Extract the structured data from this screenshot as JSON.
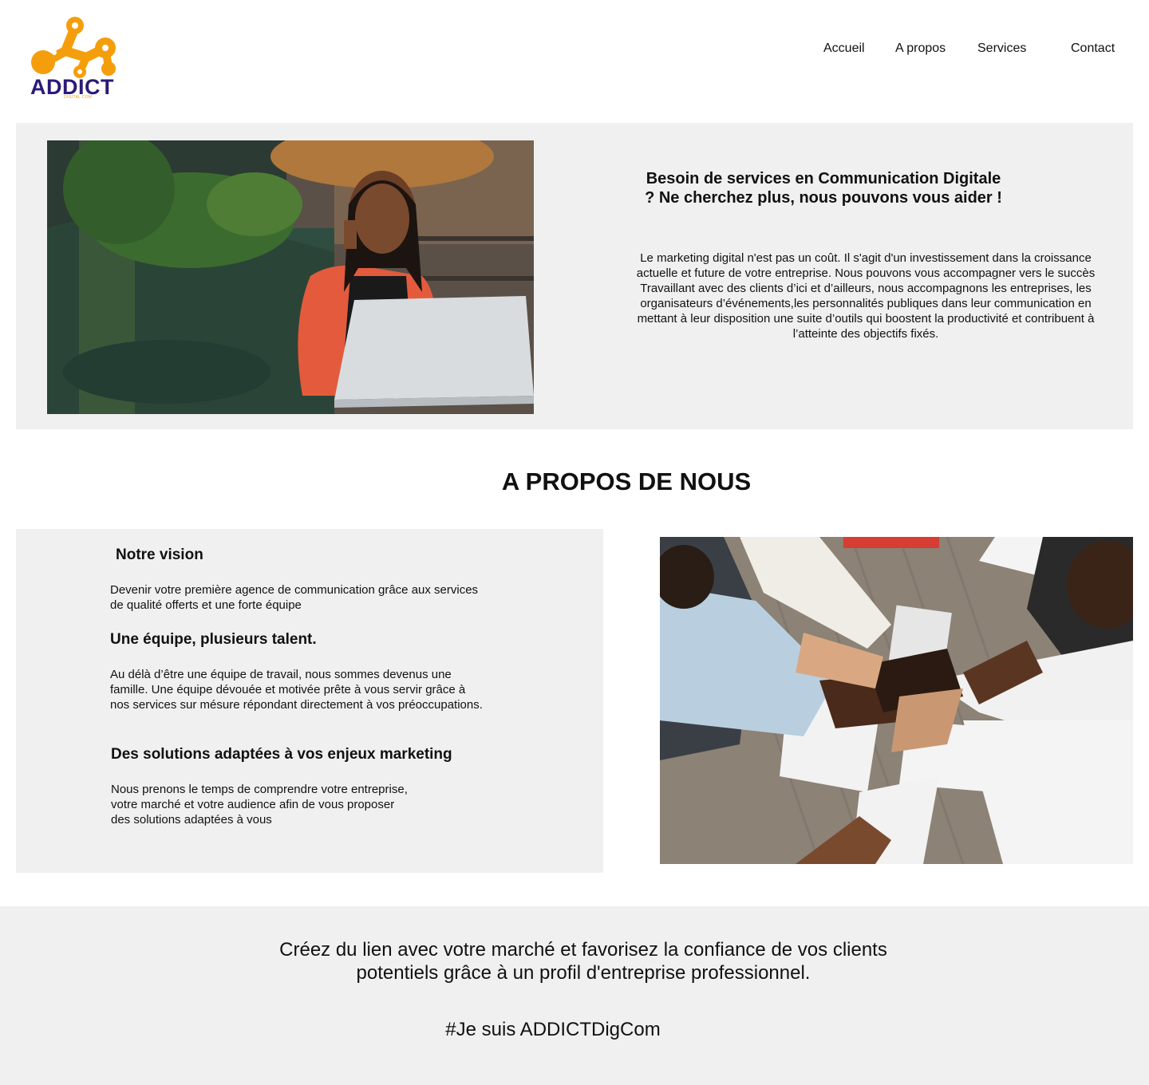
{
  "brand": {
    "name": "ADDICT",
    "tagline": "DIGITAL COM",
    "colors": {
      "primary": "#2a1a78",
      "accent": "#f59e0b"
    }
  },
  "nav": {
    "items": [
      {
        "label": "Accueil"
      },
      {
        "label": "A propos"
      },
      {
        "label": "Services"
      },
      {
        "label": "Contact"
      }
    ]
  },
  "hero": {
    "title": "Besoin de services en Communication Digitale ? Ne cherchez plus, nous pouvons vous aider !",
    "text": "Le marketing digital n'est pas un coût. Il s'agit d'un investissement dans la croissance actuelle et future de votre entreprise. Nous pouvons vous accompagner vers le succès Travaillant avec des clients d’ici et d’ailleurs, nous accompagnons les entreprises, les organisateurs d’événements,les personnalités publiques dans leur communication en mettant à leur disposition une suite d’outils qui boostent la productivité et contribuent à l’atteinte des objectifs fixés.",
    "image": "woman-phone-laptop-photo"
  },
  "about": {
    "title": "A PROPOS DE NOUS",
    "vision": {
      "heading": "Notre vision",
      "text": "Devenir votre première agence de communication grâce aux services de qualité offerts et une forte équipe"
    },
    "team": {
      "heading": "Une équipe, plusieurs talent.",
      "text": "Au délà d’être une équipe de travail, nous sommes devenus une famille. Une équipe dévouée et motivée prête à vous servir grâce à nos services sur mésure répondant directement à vos préoccupations."
    },
    "solutions": {
      "heading": "Des solutions adaptées à vos enjeux marketing",
      "text": "Nous prenons le temps de comprendre votre entreprise, votre marché et votre audience afin de vous proposer des solutions adaptées à vous"
    },
    "image": "team-hands-together-photo"
  },
  "band": {
    "text": "Créez du lien avec votre marché et favorisez la confiance de vos clients potentiels grâce à un profil d'entreprise professionnel.",
    "hashtag": "#Je suis ADDICTDigCom"
  }
}
